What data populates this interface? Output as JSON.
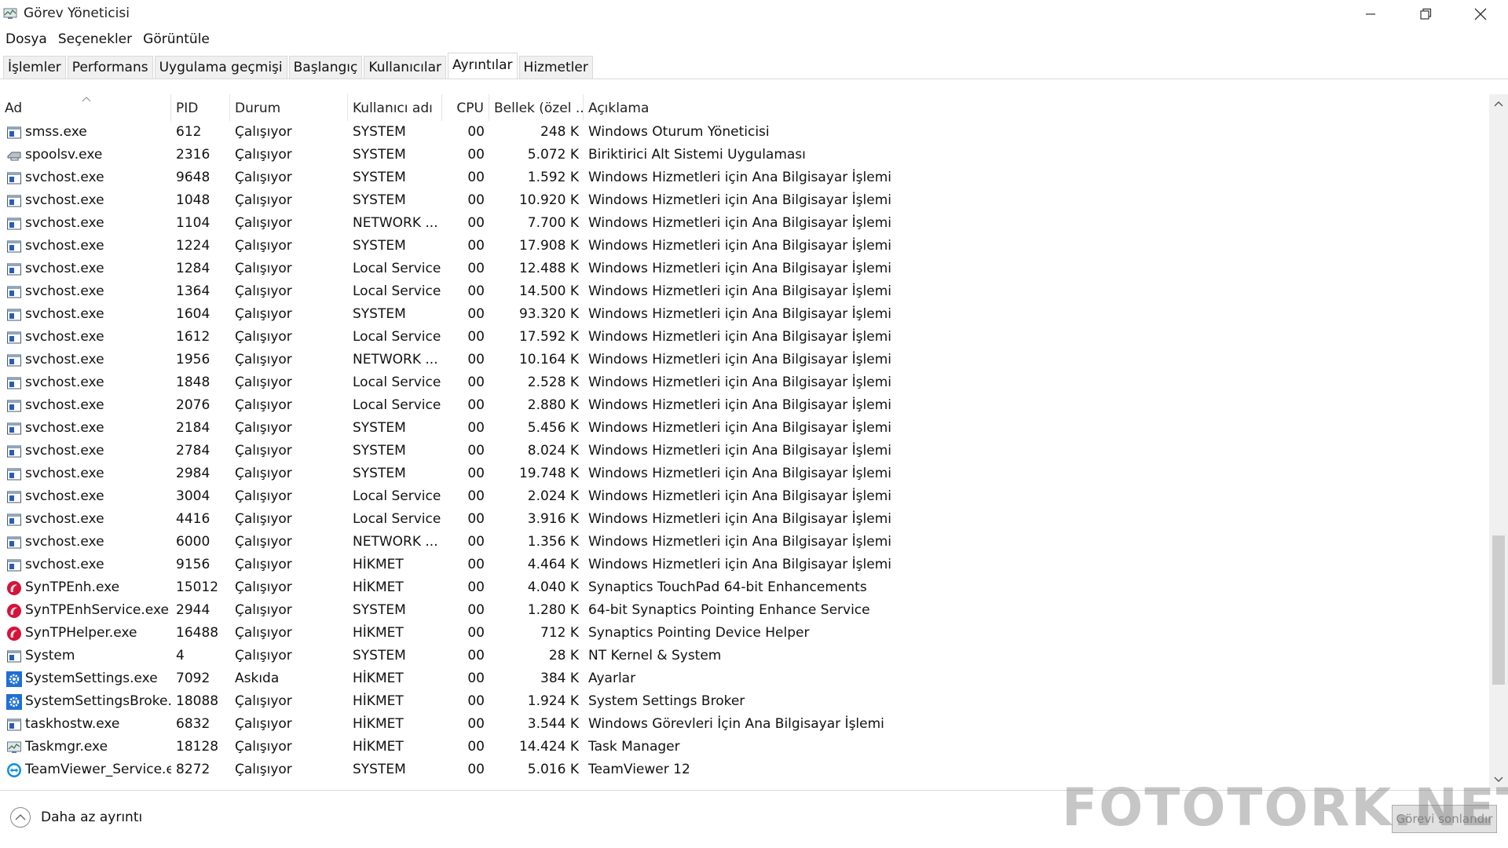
{
  "window": {
    "title": "Görev Yöneticisi",
    "controls": [
      "minimize",
      "restore",
      "close"
    ]
  },
  "menu": {
    "items": [
      "Dosya",
      "Seçenekler",
      "Görüntüle"
    ]
  },
  "tabs": {
    "items": [
      "İşlemler",
      "Performans",
      "Uygulama geçmişi",
      "Başlangıç",
      "Kullanıcılar",
      "Ayrıntılar",
      "Hizmetler"
    ],
    "active": "Ayrıntılar"
  },
  "table": {
    "columns": [
      "Ad",
      "PID",
      "Durum",
      "Kullanıcı adı",
      "CPU",
      "Bellek (özel ...",
      "Açıklama"
    ],
    "rows": [
      {
        "icon": "window-icon",
        "name": "smss.exe",
        "pid": "612",
        "status": "Çalışıyor",
        "user": "SYSTEM",
        "cpu": "00",
        "mem": "248 K",
        "desc": "Windows Oturum Yöneticisi"
      },
      {
        "icon": "printer-icon",
        "name": "spoolsv.exe",
        "pid": "2316",
        "status": "Çalışıyor",
        "user": "SYSTEM",
        "cpu": "00",
        "mem": "5.072 K",
        "desc": "Biriktirici Alt Sistemi Uygulaması"
      },
      {
        "icon": "window-icon",
        "name": "svchost.exe",
        "pid": "9648",
        "status": "Çalışıyor",
        "user": "SYSTEM",
        "cpu": "00",
        "mem": "1.592 K",
        "desc": "Windows Hizmetleri için Ana Bilgisayar İşlemi"
      },
      {
        "icon": "window-icon",
        "name": "svchost.exe",
        "pid": "1048",
        "status": "Çalışıyor",
        "user": "SYSTEM",
        "cpu": "00",
        "mem": "10.920 K",
        "desc": "Windows Hizmetleri için Ana Bilgisayar İşlemi"
      },
      {
        "icon": "window-icon",
        "name": "svchost.exe",
        "pid": "1104",
        "status": "Çalışıyor",
        "user": "NETWORK ...",
        "cpu": "00",
        "mem": "7.700 K",
        "desc": "Windows Hizmetleri için Ana Bilgisayar İşlemi"
      },
      {
        "icon": "window-icon",
        "name": "svchost.exe",
        "pid": "1224",
        "status": "Çalışıyor",
        "user": "SYSTEM",
        "cpu": "00",
        "mem": "17.908 K",
        "desc": "Windows Hizmetleri için Ana Bilgisayar İşlemi"
      },
      {
        "icon": "window-icon",
        "name": "svchost.exe",
        "pid": "1284",
        "status": "Çalışıyor",
        "user": "Local Service",
        "cpu": "00",
        "mem": "12.488 K",
        "desc": "Windows Hizmetleri için Ana Bilgisayar İşlemi"
      },
      {
        "icon": "window-icon",
        "name": "svchost.exe",
        "pid": "1364",
        "status": "Çalışıyor",
        "user": "Local Service",
        "cpu": "00",
        "mem": "14.500 K",
        "desc": "Windows Hizmetleri için Ana Bilgisayar İşlemi"
      },
      {
        "icon": "window-icon",
        "name": "svchost.exe",
        "pid": "1604",
        "status": "Çalışıyor",
        "user": "SYSTEM",
        "cpu": "00",
        "mem": "93.320 K",
        "desc": "Windows Hizmetleri için Ana Bilgisayar İşlemi"
      },
      {
        "icon": "window-icon",
        "name": "svchost.exe",
        "pid": "1612",
        "status": "Çalışıyor",
        "user": "Local Service",
        "cpu": "00",
        "mem": "17.592 K",
        "desc": "Windows Hizmetleri için Ana Bilgisayar İşlemi"
      },
      {
        "icon": "window-icon",
        "name": "svchost.exe",
        "pid": "1956",
        "status": "Çalışıyor",
        "user": "NETWORK ...",
        "cpu": "00",
        "mem": "10.164 K",
        "desc": "Windows Hizmetleri için Ana Bilgisayar İşlemi"
      },
      {
        "icon": "window-icon",
        "name": "svchost.exe",
        "pid": "1848",
        "status": "Çalışıyor",
        "user": "Local Service",
        "cpu": "00",
        "mem": "2.528 K",
        "desc": "Windows Hizmetleri için Ana Bilgisayar İşlemi"
      },
      {
        "icon": "window-icon",
        "name": "svchost.exe",
        "pid": "2076",
        "status": "Çalışıyor",
        "user": "Local Service",
        "cpu": "00",
        "mem": "2.880 K",
        "desc": "Windows Hizmetleri için Ana Bilgisayar İşlemi"
      },
      {
        "icon": "window-icon",
        "name": "svchost.exe",
        "pid": "2184",
        "status": "Çalışıyor",
        "user": "SYSTEM",
        "cpu": "00",
        "mem": "5.456 K",
        "desc": "Windows Hizmetleri için Ana Bilgisayar İşlemi"
      },
      {
        "icon": "window-icon",
        "name": "svchost.exe",
        "pid": "2784",
        "status": "Çalışıyor",
        "user": "SYSTEM",
        "cpu": "00",
        "mem": "8.024 K",
        "desc": "Windows Hizmetleri için Ana Bilgisayar İşlemi"
      },
      {
        "icon": "window-icon",
        "name": "svchost.exe",
        "pid": "2984",
        "status": "Çalışıyor",
        "user": "SYSTEM",
        "cpu": "00",
        "mem": "19.748 K",
        "desc": "Windows Hizmetleri için Ana Bilgisayar İşlemi"
      },
      {
        "icon": "window-icon",
        "name": "svchost.exe",
        "pid": "3004",
        "status": "Çalışıyor",
        "user": "Local Service",
        "cpu": "00",
        "mem": "2.024 K",
        "desc": "Windows Hizmetleri için Ana Bilgisayar İşlemi"
      },
      {
        "icon": "window-icon",
        "name": "svchost.exe",
        "pid": "4416",
        "status": "Çalışıyor",
        "user": "Local Service",
        "cpu": "00",
        "mem": "3.916 K",
        "desc": "Windows Hizmetleri için Ana Bilgisayar İşlemi"
      },
      {
        "icon": "window-icon",
        "name": "svchost.exe",
        "pid": "6000",
        "status": "Çalışıyor",
        "user": "NETWORK ...",
        "cpu": "00",
        "mem": "1.356 K",
        "desc": "Windows Hizmetleri için Ana Bilgisayar İşlemi"
      },
      {
        "icon": "window-icon",
        "name": "svchost.exe",
        "pid": "9156",
        "status": "Çalışıyor",
        "user": "HİKMET",
        "cpu": "00",
        "mem": "4.464 K",
        "desc": "Windows Hizmetleri için Ana Bilgisayar İşlemi"
      },
      {
        "icon": "synaptics-icon",
        "name": "SynTPEnh.exe",
        "pid": "15012",
        "status": "Çalışıyor",
        "user": "HİKMET",
        "cpu": "00",
        "mem": "4.040 K",
        "desc": "Synaptics TouchPad 64-bit Enhancements"
      },
      {
        "icon": "synaptics-icon",
        "name": "SynTPEnhService.exe",
        "pid": "2944",
        "status": "Çalışıyor",
        "user": "SYSTEM",
        "cpu": "00",
        "mem": "1.280 K",
        "desc": "64-bit Synaptics Pointing Enhance Service"
      },
      {
        "icon": "synaptics-icon",
        "name": "SynTPHelper.exe",
        "pid": "16488",
        "status": "Çalışıyor",
        "user": "HİKMET",
        "cpu": "00",
        "mem": "712 K",
        "desc": "Synaptics Pointing Device Helper"
      },
      {
        "icon": "window-icon",
        "name": "System",
        "pid": "4",
        "status": "Çalışıyor",
        "user": "SYSTEM",
        "cpu": "00",
        "mem": "28 K",
        "desc": "NT Kernel & System"
      },
      {
        "icon": "gear-icon",
        "name": "SystemSettings.exe",
        "pid": "7092",
        "status": "Askıda",
        "user": "HİKMET",
        "cpu": "00",
        "mem": "384 K",
        "desc": "Ayarlar"
      },
      {
        "icon": "gear-icon",
        "name": "SystemSettingsBroke...",
        "pid": "18088",
        "status": "Çalışıyor",
        "user": "HİKMET",
        "cpu": "00",
        "mem": "1.924 K",
        "desc": "System Settings Broker"
      },
      {
        "icon": "window-icon",
        "name": "taskhostw.exe",
        "pid": "6832",
        "status": "Çalışıyor",
        "user": "HİKMET",
        "cpu": "00",
        "mem": "3.544 K",
        "desc": "Windows Görevleri İçin Ana Bilgisayar İşlemi"
      },
      {
        "icon": "taskmgr-icon",
        "name": "Taskmgr.exe",
        "pid": "18128",
        "status": "Çalışıyor",
        "user": "HİKMET",
        "cpu": "00",
        "mem": "14.424 K",
        "desc": "Task Manager"
      },
      {
        "icon": "teamviewer-icon",
        "name": "TeamViewer_Service.e...",
        "pid": "8272",
        "status": "Çalışıyor",
        "user": "SYSTEM",
        "cpu": "00",
        "mem": "5.016 K",
        "desc": "TeamViewer 12"
      }
    ]
  },
  "footer": {
    "less_details": "Daha az ayrıntı",
    "end_task": "Görevi sonlandır"
  },
  "watermark": "FOTOTORK.NET",
  "colors": {
    "synaptics": "#d4143a",
    "svc_blue": "#2a5db0",
    "gear_blue": "#1f6fd6",
    "teamviewer": "#0e8ee9"
  }
}
